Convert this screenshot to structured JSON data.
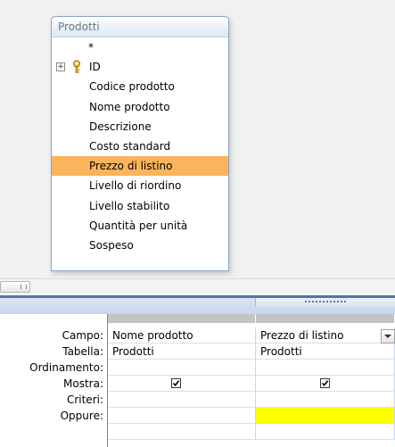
{
  "table": {
    "title": "Prodotti",
    "fields": [
      "*",
      "ID",
      "Codice prodotto",
      "Nome prodotto",
      "Descrizione",
      "Costo standard",
      "Prezzo di listino",
      "Livello di riordino",
      "Livello stabilito",
      "Quantità per unità",
      "Sospeso"
    ],
    "selected_field": "Prezzo di listino",
    "primary_key": "ID"
  },
  "grid": {
    "row_labels": {
      "field": "Campo:",
      "table": "Tabella:",
      "sort": "Ordinamento:",
      "show": "Mostra:",
      "criteria": "Criteri:",
      "or": "Oppure:"
    },
    "columns": [
      {
        "field": "Nome prodotto",
        "table": "Prodotti",
        "sort": "",
        "show": true,
        "criteria": "",
        "or": ""
      },
      {
        "field": "Prezzo di listino",
        "table": "Prodotti",
        "sort": "",
        "show": true,
        "criteria": "",
        "or": ""
      }
    ]
  },
  "colors": {
    "selected_field_bg": "#fbb45b",
    "splitter": "#4d76b2",
    "highlight_cell": "#ffff00"
  },
  "icons": [
    "expand-icon",
    "primary-key-icon",
    "dropdown-arrow-icon",
    "checkbox-icon"
  ]
}
